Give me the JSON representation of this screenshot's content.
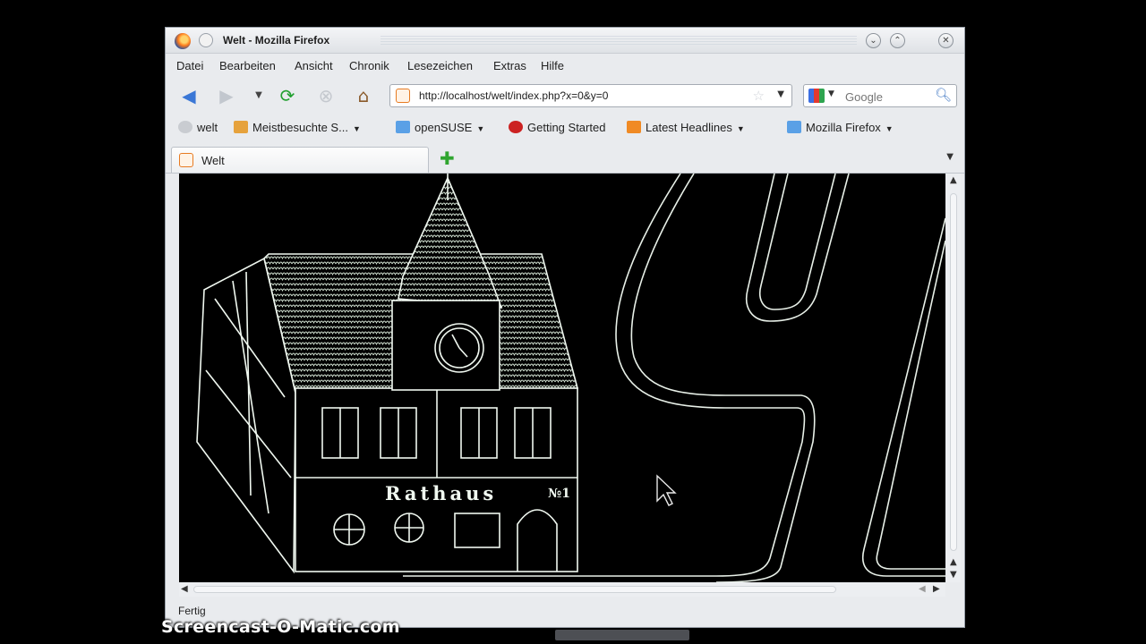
{
  "window": {
    "title": "Welt - Mozilla Firefox"
  },
  "menu": [
    "Datei",
    "Bearbeiten",
    "Ansicht",
    "Chronik",
    "Lesezeichen",
    "Extras",
    "Hilfe"
  ],
  "navigation": {
    "url": "http://localhost/welt/index.php?x=0&y=0",
    "search_placeholder": "Google"
  },
  "bookmarks": [
    {
      "label": "welt",
      "icon": "page-icon",
      "color": "#9aa0a6",
      "dropdown": false
    },
    {
      "label": "Meistbesuchte S...",
      "icon": "folder-icon",
      "color": "#e6a23c",
      "dropdown": true
    },
    {
      "label": "openSUSE",
      "icon": "folder-icon",
      "color": "#5aa0e6",
      "dropdown": true
    },
    {
      "label": "Getting Started",
      "icon": "firefox-icon",
      "color": "#cc2222",
      "dropdown": false
    },
    {
      "label": "Latest Headlines",
      "icon": "rss-icon",
      "color": "#f08a24",
      "dropdown": true
    },
    {
      "label": "Mozilla Firefox",
      "icon": "folder-icon",
      "color": "#5aa0e6",
      "dropdown": true
    }
  ],
  "tabs": [
    {
      "label": "Welt"
    }
  ],
  "page": {
    "sign_text": "Rathaus",
    "sign_number": "№1"
  },
  "status": "Fertig",
  "watermark": "Screencast-O-Matic.com"
}
